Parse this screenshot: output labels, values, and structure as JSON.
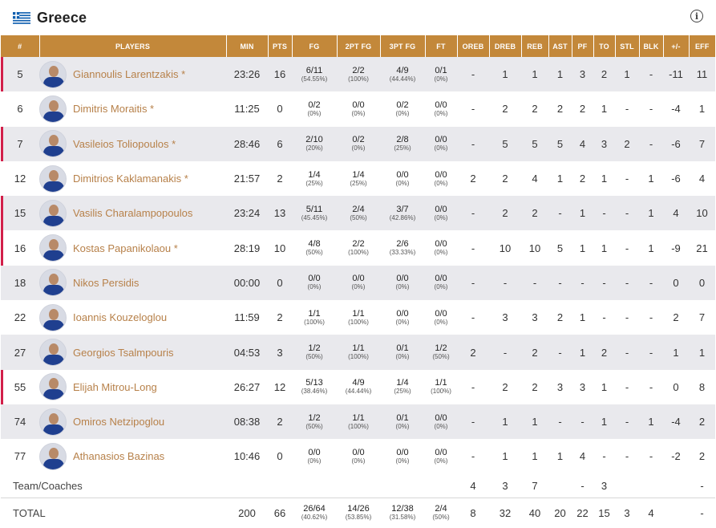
{
  "team": {
    "name": "Greece",
    "flag_icon": "greece-flag-icon",
    "info_icon": "info-icon"
  },
  "colors": {
    "header_bg": "#c3883a",
    "player_link": "#b7814a",
    "starter_marker": "#d21f4a",
    "row_alt": "#e9e9ed"
  },
  "columns": [
    "#",
    "PLAYERS",
    "MIN",
    "PTS",
    "FG",
    "2PT FG",
    "3PT FG",
    "FT",
    "OREB",
    "DREB",
    "REB",
    "AST",
    "PF",
    "TO",
    "STL",
    "BLK",
    "+/-",
    "EFF"
  ],
  "players": [
    {
      "num": "5",
      "name": "Giannoulis Larentzakis *",
      "starter": true,
      "min": "23:26",
      "pts": "16",
      "fg": "6/11",
      "fg_pct": "(54.55%)",
      "fg2": "2/2",
      "fg2_pct": "(100%)",
      "fg3": "4/9",
      "fg3_pct": "(44.44%)",
      "ft": "0/1",
      "ft_pct": "(0%)",
      "oreb": "-",
      "dreb": "1",
      "reb": "1",
      "ast": "1",
      "pf": "3",
      "to": "2",
      "stl": "1",
      "blk": "-",
      "pm": "-11",
      "eff": "11"
    },
    {
      "num": "6",
      "name": "Dimitris Moraitis *",
      "starter": false,
      "min": "11:25",
      "pts": "0",
      "fg": "0/2",
      "fg_pct": "(0%)",
      "fg2": "0/0",
      "fg2_pct": "(0%)",
      "fg3": "0/2",
      "fg3_pct": "(0%)",
      "ft": "0/0",
      "ft_pct": "(0%)",
      "oreb": "-",
      "dreb": "2",
      "reb": "2",
      "ast": "2",
      "pf": "2",
      "to": "1",
      "stl": "-",
      "blk": "-",
      "pm": "-4",
      "eff": "1"
    },
    {
      "num": "7",
      "name": "Vasileios Toliopoulos *",
      "starter": true,
      "min": "28:46",
      "pts": "6",
      "fg": "2/10",
      "fg_pct": "(20%)",
      "fg2": "0/2",
      "fg2_pct": "(0%)",
      "fg3": "2/8",
      "fg3_pct": "(25%)",
      "ft": "0/0",
      "ft_pct": "(0%)",
      "oreb": "-",
      "dreb": "5",
      "reb": "5",
      "ast": "5",
      "pf": "4",
      "to": "3",
      "stl": "2",
      "blk": "-",
      "pm": "-6",
      "eff": "7"
    },
    {
      "num": "12",
      "name": "Dimitrios Kaklamanakis *",
      "starter": false,
      "min": "21:57",
      "pts": "2",
      "fg": "1/4",
      "fg_pct": "(25%)",
      "fg2": "1/4",
      "fg2_pct": "(25%)",
      "fg3": "0/0",
      "fg3_pct": "(0%)",
      "ft": "0/0",
      "ft_pct": "(0%)",
      "oreb": "2",
      "dreb": "2",
      "reb": "4",
      "ast": "1",
      "pf": "2",
      "to": "1",
      "stl": "-",
      "blk": "1",
      "pm": "-6",
      "eff": "4"
    },
    {
      "num": "15",
      "name": "Vasilis Charalampopoulos",
      "starter": true,
      "min": "23:24",
      "pts": "13",
      "fg": "5/11",
      "fg_pct": "(45.45%)",
      "fg2": "2/4",
      "fg2_pct": "(50%)",
      "fg3": "3/7",
      "fg3_pct": "(42.86%)",
      "ft": "0/0",
      "ft_pct": "(0%)",
      "oreb": "-",
      "dreb": "2",
      "reb": "2",
      "ast": "-",
      "pf": "1",
      "to": "-",
      "stl": "-",
      "blk": "1",
      "pm": "4",
      "eff": "10"
    },
    {
      "num": "16",
      "name": "Kostas Papanikolaou *",
      "starter": true,
      "min": "28:19",
      "pts": "10",
      "fg": "4/8",
      "fg_pct": "(50%)",
      "fg2": "2/2",
      "fg2_pct": "(100%)",
      "fg3": "2/6",
      "fg3_pct": "(33.33%)",
      "ft": "0/0",
      "ft_pct": "(0%)",
      "oreb": "-",
      "dreb": "10",
      "reb": "10",
      "ast": "5",
      "pf": "1",
      "to": "1",
      "stl": "-",
      "blk": "1",
      "pm": "-9",
      "eff": "21"
    },
    {
      "num": "18",
      "name": "Nikos Persidis",
      "starter": false,
      "min": "00:00",
      "pts": "0",
      "fg": "0/0",
      "fg_pct": "(0%)",
      "fg2": "0/0",
      "fg2_pct": "(0%)",
      "fg3": "0/0",
      "fg3_pct": "(0%)",
      "ft": "0/0",
      "ft_pct": "(0%)",
      "oreb": "-",
      "dreb": "-",
      "reb": "-",
      "ast": "-",
      "pf": "-",
      "to": "-",
      "stl": "-",
      "blk": "-",
      "pm": "0",
      "eff": "0"
    },
    {
      "num": "22",
      "name": "Ioannis Kouzeloglou",
      "starter": false,
      "min": "11:59",
      "pts": "2",
      "fg": "1/1",
      "fg_pct": "(100%)",
      "fg2": "1/1",
      "fg2_pct": "(100%)",
      "fg3": "0/0",
      "fg3_pct": "(0%)",
      "ft": "0/0",
      "ft_pct": "(0%)",
      "oreb": "-",
      "dreb": "3",
      "reb": "3",
      "ast": "2",
      "pf": "1",
      "to": "-",
      "stl": "-",
      "blk": "-",
      "pm": "2",
      "eff": "7"
    },
    {
      "num": "27",
      "name": "Georgios Tsalmpouris",
      "starter": false,
      "min": "04:53",
      "pts": "3",
      "fg": "1/2",
      "fg_pct": "(50%)",
      "fg2": "1/1",
      "fg2_pct": "(100%)",
      "fg3": "0/1",
      "fg3_pct": "(0%)",
      "ft": "1/2",
      "ft_pct": "(50%)",
      "oreb": "2",
      "dreb": "-",
      "reb": "2",
      "ast": "-",
      "pf": "1",
      "to": "2",
      "stl": "-",
      "blk": "-",
      "pm": "1",
      "eff": "1"
    },
    {
      "num": "55",
      "name": "Elijah Mitrou-Long",
      "starter": true,
      "min": "26:27",
      "pts": "12",
      "fg": "5/13",
      "fg_pct": "(38.46%)",
      "fg2": "4/9",
      "fg2_pct": "(44.44%)",
      "fg3": "1/4",
      "fg3_pct": "(25%)",
      "ft": "1/1",
      "ft_pct": "(100%)",
      "oreb": "-",
      "dreb": "2",
      "reb": "2",
      "ast": "3",
      "pf": "3",
      "to": "1",
      "stl": "-",
      "blk": "-",
      "pm": "0",
      "eff": "8"
    },
    {
      "num": "74",
      "name": "Omiros Netzipoglou",
      "starter": false,
      "min": "08:38",
      "pts": "2",
      "fg": "1/2",
      "fg_pct": "(50%)",
      "fg2": "1/1",
      "fg2_pct": "(100%)",
      "fg3": "0/1",
      "fg3_pct": "(0%)",
      "ft": "0/0",
      "ft_pct": "(0%)",
      "oreb": "-",
      "dreb": "1",
      "reb": "1",
      "ast": "-",
      "pf": "-",
      "to": "1",
      "stl": "-",
      "blk": "1",
      "pm": "-4",
      "eff": "2"
    },
    {
      "num": "77",
      "name": "Athanasios Bazinas",
      "starter": false,
      "min": "10:46",
      "pts": "0",
      "fg": "0/0",
      "fg_pct": "(0%)",
      "fg2": "0/0",
      "fg2_pct": "(0%)",
      "fg3": "0/0",
      "fg3_pct": "(0%)",
      "ft": "0/0",
      "ft_pct": "(0%)",
      "oreb": "-",
      "dreb": "1",
      "reb": "1",
      "ast": "1",
      "pf": "4",
      "to": "-",
      "stl": "-",
      "blk": "-",
      "pm": "-2",
      "eff": "2"
    }
  ],
  "team_coaches": {
    "label": "Team/Coaches",
    "oreb": "4",
    "dreb": "3",
    "reb": "7",
    "pf": "-",
    "to": "3",
    "eff": "-"
  },
  "total": {
    "label": "TOTAL",
    "min": "200",
    "pts": "66",
    "fg": "26/64",
    "fg_pct": "(40.62%)",
    "fg2": "14/26",
    "fg2_pct": "(53.85%)",
    "fg3": "12/38",
    "fg3_pct": "(31.58%)",
    "ft": "2/4",
    "ft_pct": "(50%)",
    "oreb": "8",
    "dreb": "32",
    "reb": "40",
    "ast": "20",
    "pf": "22",
    "to": "15",
    "stl": "3",
    "blk": "4",
    "pm": "",
    "eff": "-"
  }
}
